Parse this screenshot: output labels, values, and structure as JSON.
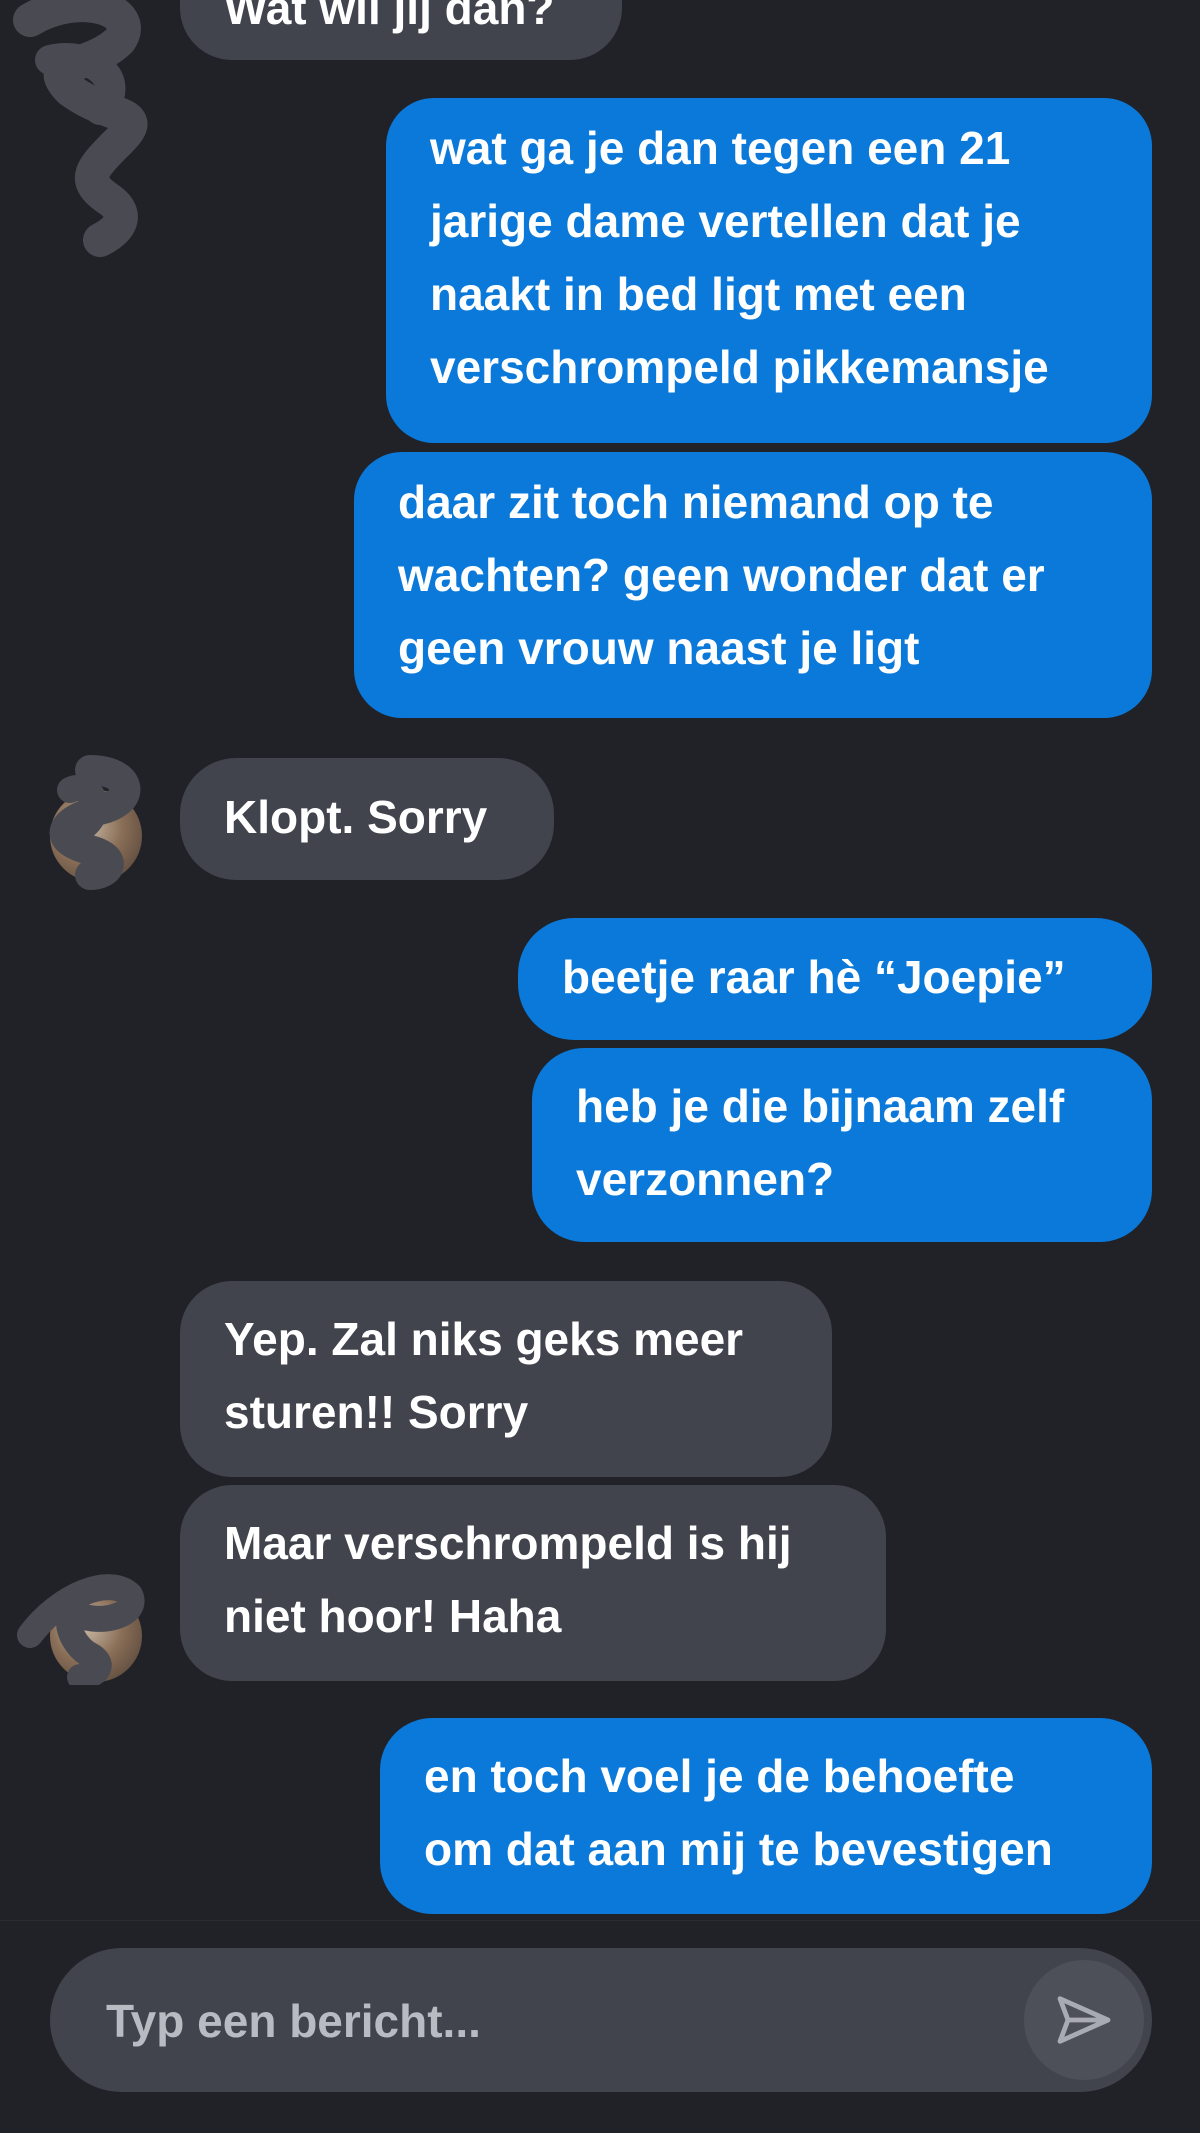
{
  "messages": [
    {
      "direction": "in",
      "lines": [
        "Wat wil jij dan?"
      ]
    },
    {
      "direction": "out",
      "lines": [
        "wat ga je dan tegen een 21",
        "jarige dame vertellen dat je",
        "naakt in bed ligt met een",
        "verschrompeld pikkemansje"
      ]
    },
    {
      "direction": "out",
      "lines": [
        "daar zit toch niemand op te",
        "wachten? geen wonder dat er",
        "geen vrouw naast je ligt"
      ]
    },
    {
      "direction": "in",
      "lines": [
        "Klopt. Sorry"
      ]
    },
    {
      "direction": "out",
      "lines": [
        "beetje raar hè “Joepie”"
      ]
    },
    {
      "direction": "out",
      "lines": [
        "heb je die bijnaam zelf",
        "verzonnen?"
      ]
    },
    {
      "direction": "in",
      "lines": [
        "Yep. Zal niks geks meer",
        "sturen!! Sorry"
      ]
    },
    {
      "direction": "in",
      "lines": [
        "Maar verschrompeld is hij",
        "niet hoor! Haha"
      ]
    },
    {
      "direction": "out",
      "lines": [
        "en toch voel je de behoefte",
        "om dat aan mij te bevestigen"
      ]
    }
  ],
  "composer": {
    "placeholder": "Typ een bericht..."
  },
  "icons": {
    "send": "send-icon",
    "avatar": "contact-avatar"
  },
  "colors": {
    "background": "#212228",
    "outgoing_bubble": "#0a79d9",
    "incoming_bubble": "#41434d",
    "text": "#ffffff"
  }
}
